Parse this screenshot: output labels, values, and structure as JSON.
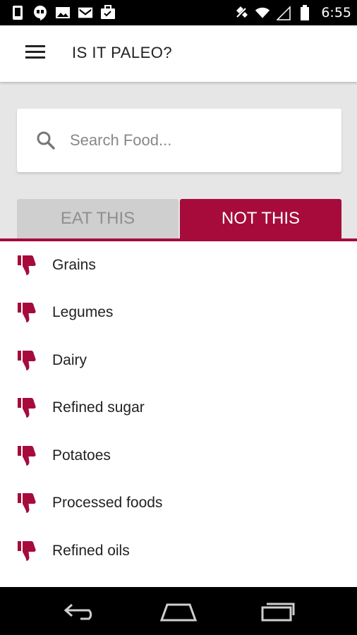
{
  "status_bar": {
    "time": "6:55",
    "left_icons": [
      "phone-icon",
      "hangouts-icon",
      "image-icon",
      "gmail-icon",
      "briefcase-icon"
    ],
    "right_icons": [
      "rotate-off-icon",
      "wifi-icon",
      "signal-icon",
      "battery-icon"
    ]
  },
  "app_bar": {
    "title": "IS IT PALEO?",
    "menu_icon": "hamburger-menu-icon"
  },
  "search": {
    "placeholder": "Search Food...",
    "value": ""
  },
  "tabs": [
    {
      "label": "EAT THIS",
      "selected": false
    },
    {
      "label": "NOT THIS",
      "selected": true
    }
  ],
  "colors": {
    "accent": "#a60b3c",
    "inactive_tab": "#cfcfcf",
    "inactive_tab_text": "#8f8f8f",
    "background": "#e6e6e6"
  },
  "list": {
    "icon": "thumbs-down-icon",
    "items": [
      {
        "label": "Grains"
      },
      {
        "label": "Legumes"
      },
      {
        "label": "Dairy"
      },
      {
        "label": "Refined sugar"
      },
      {
        "label": "Potatoes"
      },
      {
        "label": "Processed foods"
      },
      {
        "label": "Refined oils"
      }
    ]
  },
  "nav_bar": {
    "icons": [
      "back-icon",
      "home-icon",
      "recents-icon"
    ]
  }
}
